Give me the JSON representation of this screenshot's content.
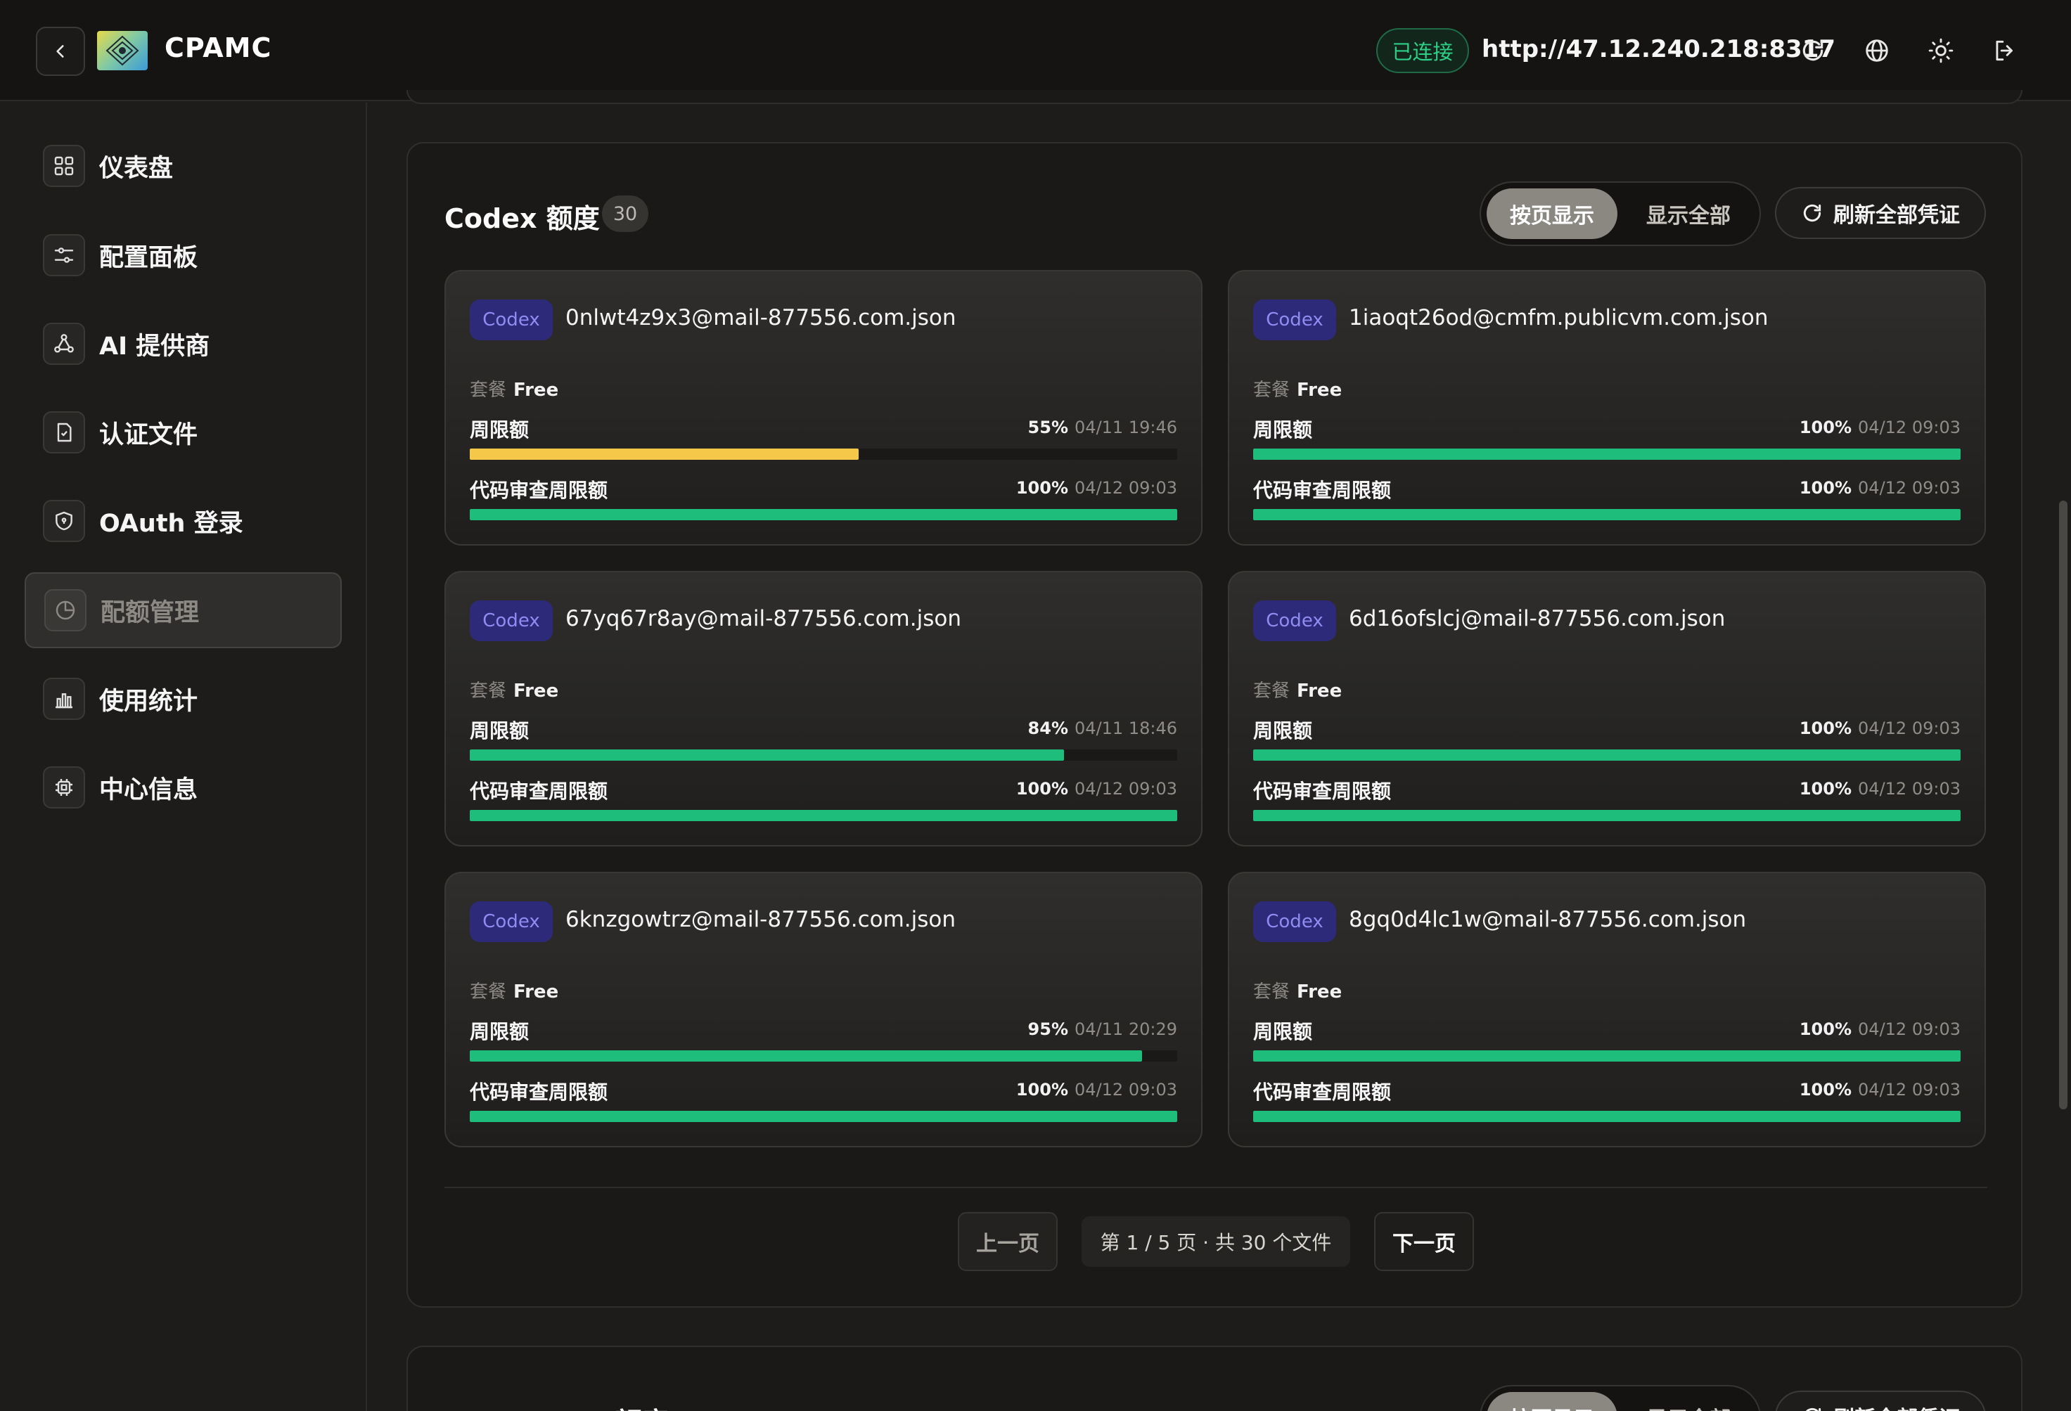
{
  "header": {
    "app_title": "CPAMC",
    "status": "已连接",
    "server_url": "http://47.12.240.218:8317"
  },
  "sidebar": {
    "items": [
      {
        "label": "仪表盘",
        "icon": "dashboard-icon"
      },
      {
        "label": "配置面板",
        "icon": "sliders-icon"
      },
      {
        "label": "AI 提供商",
        "icon": "network-icon"
      },
      {
        "label": "认证文件",
        "icon": "file-check-icon"
      },
      {
        "label": "OAuth 登录",
        "icon": "shield-icon"
      },
      {
        "label": "配额管理",
        "icon": "pie-chart-icon",
        "active": true
      },
      {
        "label": "使用统计",
        "icon": "bar-chart-icon"
      },
      {
        "label": "中心信息",
        "icon": "chip-icon"
      }
    ]
  },
  "panel": {
    "title": "Codex 额度",
    "count": "30",
    "toggle_paged": "按页显示",
    "toggle_all": "显示全部",
    "refresh_label": "刷新全部凭证",
    "plan_label": "套餐",
    "cards": [
      {
        "tag": "Codex",
        "file": "0nlwt4z9x3@mail-877556.com.json",
        "plan": "Free",
        "quotas": [
          {
            "name": "周限额",
            "pct": "55%",
            "fraction": 0.55,
            "time": "04/11 19:46",
            "color": "#f5c84a"
          },
          {
            "name": "代码审查周限额",
            "pct": "100%",
            "fraction": 1.0,
            "time": "04/12 09:03",
            "color": "#1fbd7c"
          }
        ]
      },
      {
        "tag": "Codex",
        "file": "1iaoqt26od@cmfm.publicvm.com.json",
        "plan": "Free",
        "quotas": [
          {
            "name": "周限额",
            "pct": "100%",
            "fraction": 1.0,
            "time": "04/12 09:03",
            "color": "#1fbd7c"
          },
          {
            "name": "代码审查周限额",
            "pct": "100%",
            "fraction": 1.0,
            "time": "04/12 09:03",
            "color": "#1fbd7c"
          }
        ]
      },
      {
        "tag": "Codex",
        "file": "67yq67r8ay@mail-877556.com.json",
        "plan": "Free",
        "quotas": [
          {
            "name": "周限额",
            "pct": "84%",
            "fraction": 0.84,
            "time": "04/11 18:46",
            "color": "#1fbd7c"
          },
          {
            "name": "代码审查周限额",
            "pct": "100%",
            "fraction": 1.0,
            "time": "04/12 09:03",
            "color": "#1fbd7c"
          }
        ]
      },
      {
        "tag": "Codex",
        "file": "6d16ofslcj@mail-877556.com.json",
        "plan": "Free",
        "quotas": [
          {
            "name": "周限额",
            "pct": "100%",
            "fraction": 1.0,
            "time": "04/12 09:03",
            "color": "#1fbd7c"
          },
          {
            "name": "代码审查周限额",
            "pct": "100%",
            "fraction": 1.0,
            "time": "04/12 09:03",
            "color": "#1fbd7c"
          }
        ]
      },
      {
        "tag": "Codex",
        "file": "6knzgowtrz@mail-877556.com.json",
        "plan": "Free",
        "quotas": [
          {
            "name": "周限额",
            "pct": "95%",
            "fraction": 0.95,
            "time": "04/11 20:29",
            "color": "#1fbd7c"
          },
          {
            "name": "代码审查周限额",
            "pct": "100%",
            "fraction": 1.0,
            "time": "04/12 09:03",
            "color": "#1fbd7c"
          }
        ]
      },
      {
        "tag": "Codex",
        "file": "8gq0d4lc1w@mail-877556.com.json",
        "plan": "Free",
        "quotas": [
          {
            "name": "周限额",
            "pct": "100%",
            "fraction": 1.0,
            "time": "04/12 09:03",
            "color": "#1fbd7c"
          },
          {
            "name": "代码审查周限额",
            "pct": "100%",
            "fraction": 1.0,
            "time": "04/12 09:03",
            "color": "#1fbd7c"
          }
        ]
      }
    ],
    "pagination": {
      "prev": "上一页",
      "info": "第 1 / 5 页 · 共 30 个文件",
      "next": "下一页"
    }
  },
  "panel2": {
    "title": "Gemini CLI 额度",
    "toggle_paged": "按页显示",
    "toggle_all": "显示全部",
    "refresh_label": "刷新全部凭证"
  }
}
